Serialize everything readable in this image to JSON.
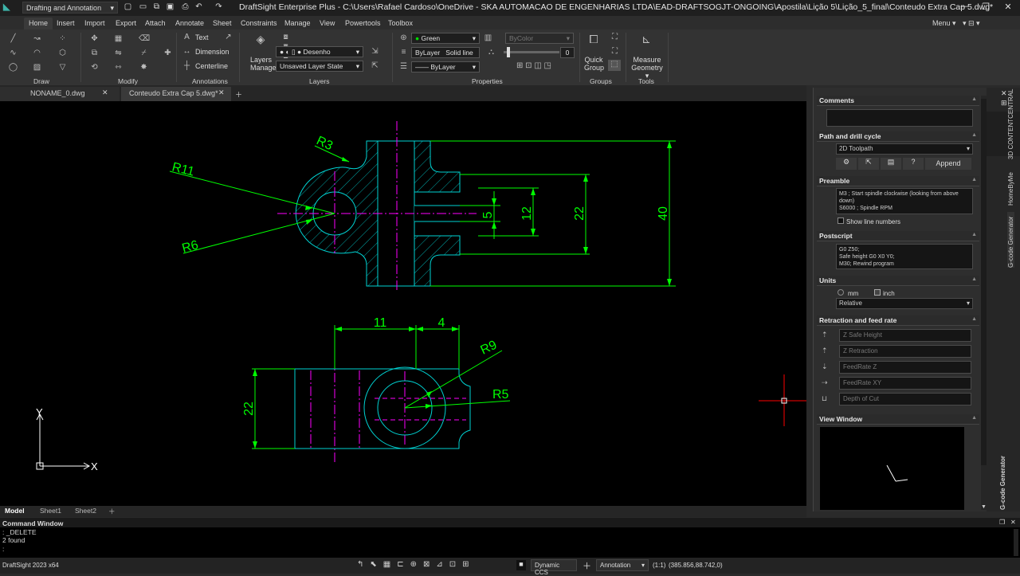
{
  "window": {
    "title": "DraftSight Enterprise Plus - C:\\Users\\Rafael Cardoso\\OneDrive - SKA AUTOMACAO DE ENGENHARIAS LTDA\\EAD-DRAFTSOGJT-ONGOING\\Apostila\\Lição 5\\Lição_5_final\\Conteudo Extra Cap 5.dwg*",
    "workspace": "Drafting and Annotation",
    "menu_label": "Menu"
  },
  "menu_tabs": [
    "Home",
    "Insert",
    "Import",
    "Export",
    "Attach",
    "Annotate",
    "Sheet",
    "Constraints",
    "Manage",
    "View",
    "Powertools",
    "Toolbox"
  ],
  "ribbon": {
    "groups": {
      "draw": "Draw",
      "modify": "Modify",
      "annotations": "Annotations",
      "layers": "Layers",
      "properties": "Properties",
      "groups": "Groups",
      "tools": "Tools"
    },
    "annotations": {
      "text": "Text",
      "dimension": "Dimension",
      "centerline": "Centerline"
    },
    "layers": {
      "manager_line1": "Layers",
      "manager_line2": "Manager",
      "current_layer": "Desenho",
      "layer_state": "Unsaved Layer State"
    },
    "properties": {
      "color": "Green",
      "bycolor": "ByColor",
      "linetype_layer": "ByLayer",
      "linetype": "Solid line",
      "transparency": "0",
      "lineweight": "ByLayer"
    },
    "groups_tools": {
      "quick_group_1": "Quick",
      "quick_group_2": "Group",
      "measure_1": "Measure",
      "measure_2": "Geometry"
    }
  },
  "doc_tabs": [
    "NONAME_0.dwg",
    "Conteudo Extra Cap 5.dwg*"
  ],
  "sheet_tabs": [
    "Model",
    "Sheet1",
    "Sheet2"
  ],
  "drawing": {
    "dimensions": {
      "r3": "R3",
      "r11": "R11",
      "r6": "R6",
      "d5": "5",
      "d12": "12",
      "d22_top": "22",
      "d40": "40",
      "d11": "11",
      "d4": "4",
      "r9": "R9",
      "r5": "R5",
      "d22_bottom": "22"
    },
    "ucs": {
      "x": "X",
      "y": "Y"
    }
  },
  "command_window": {
    "title": "Command Window",
    "lines": [
      ": _DELETE",
      "2 found",
      ":"
    ]
  },
  "status_bar": {
    "version": "DraftSight 2023 x64",
    "ccs": "Dynamic CCS",
    "annotation": "Annotation",
    "scale": "(1:1)",
    "coords": "(385.856,88.742,0)"
  },
  "panel": {
    "comments": {
      "header": "Comments",
      "value": ""
    },
    "path": {
      "header": "Path and drill cycle",
      "value": "2D Toolpath",
      "append": "Append",
      "help": "?"
    },
    "preamble": {
      "header": "Preamble",
      "line1": "M3    ; Start spindle clockwise (looking from above down)",
      "line2": "S6000  ; Spindle RPM",
      "show_line_numbers": "Show line numbers"
    },
    "postscript": {
      "header": "Postscript",
      "line1": "G0 Z50;",
      "line2": "Safe height G0 X0 Y0;",
      "line3": "M30; Rewind program"
    },
    "units": {
      "header": "Units",
      "mm": "mm",
      "inch": "inch",
      "mode": "Relative"
    },
    "retraction": {
      "header": "Retraction and feed rate",
      "z_safe": "Z Safe Height",
      "z_retraction": "Z Retraction",
      "feed_z": "FeedRate Z",
      "feed_xy": "FeedRate XY",
      "depth": "Depth of Cut"
    },
    "view_window": {
      "header": "View Window"
    }
  },
  "side_tabs": {
    "content_central": "3D CONTENTCENTRAL",
    "home_by_me": "HomeByMe",
    "gcode_top": "G-code Generator",
    "gcode_bottom": "G-code Generator"
  },
  "colors": {
    "green": "#00ff00",
    "cyan": "#00d2d2",
    "magenta": "#ff00ff",
    "background": "#000000"
  }
}
